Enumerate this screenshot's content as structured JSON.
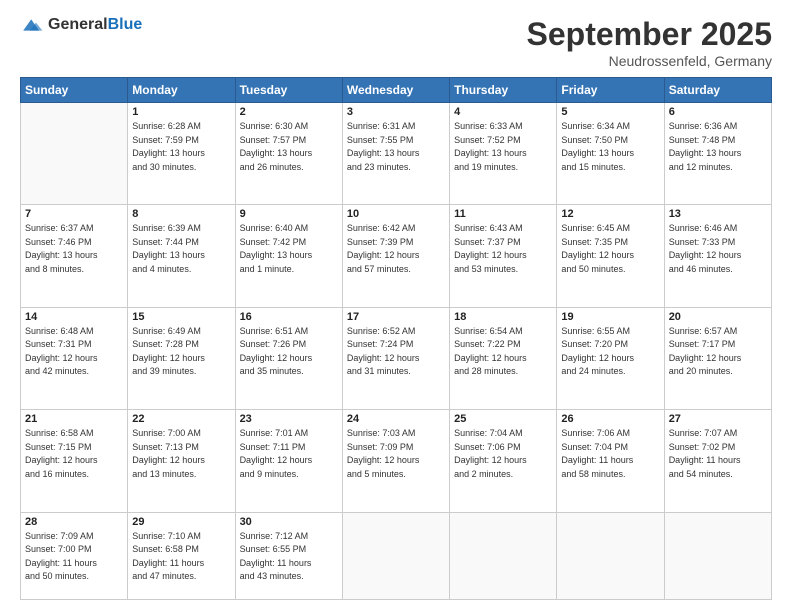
{
  "header": {
    "logo_line1": "General",
    "logo_line2": "Blue",
    "month": "September 2025",
    "location": "Neudrossenfeld, Germany"
  },
  "weekdays": [
    "Sunday",
    "Monday",
    "Tuesday",
    "Wednesday",
    "Thursday",
    "Friday",
    "Saturday"
  ],
  "weeks": [
    [
      {
        "day": "",
        "info": ""
      },
      {
        "day": "1",
        "info": "Sunrise: 6:28 AM\nSunset: 7:59 PM\nDaylight: 13 hours\nand 30 minutes."
      },
      {
        "day": "2",
        "info": "Sunrise: 6:30 AM\nSunset: 7:57 PM\nDaylight: 13 hours\nand 26 minutes."
      },
      {
        "day": "3",
        "info": "Sunrise: 6:31 AM\nSunset: 7:55 PM\nDaylight: 13 hours\nand 23 minutes."
      },
      {
        "day": "4",
        "info": "Sunrise: 6:33 AM\nSunset: 7:52 PM\nDaylight: 13 hours\nand 19 minutes."
      },
      {
        "day": "5",
        "info": "Sunrise: 6:34 AM\nSunset: 7:50 PM\nDaylight: 13 hours\nand 15 minutes."
      },
      {
        "day": "6",
        "info": "Sunrise: 6:36 AM\nSunset: 7:48 PM\nDaylight: 13 hours\nand 12 minutes."
      }
    ],
    [
      {
        "day": "7",
        "info": "Sunrise: 6:37 AM\nSunset: 7:46 PM\nDaylight: 13 hours\nand 8 minutes."
      },
      {
        "day": "8",
        "info": "Sunrise: 6:39 AM\nSunset: 7:44 PM\nDaylight: 13 hours\nand 4 minutes."
      },
      {
        "day": "9",
        "info": "Sunrise: 6:40 AM\nSunset: 7:42 PM\nDaylight: 13 hours\nand 1 minute."
      },
      {
        "day": "10",
        "info": "Sunrise: 6:42 AM\nSunset: 7:39 PM\nDaylight: 12 hours\nand 57 minutes."
      },
      {
        "day": "11",
        "info": "Sunrise: 6:43 AM\nSunset: 7:37 PM\nDaylight: 12 hours\nand 53 minutes."
      },
      {
        "day": "12",
        "info": "Sunrise: 6:45 AM\nSunset: 7:35 PM\nDaylight: 12 hours\nand 50 minutes."
      },
      {
        "day": "13",
        "info": "Sunrise: 6:46 AM\nSunset: 7:33 PM\nDaylight: 12 hours\nand 46 minutes."
      }
    ],
    [
      {
        "day": "14",
        "info": "Sunrise: 6:48 AM\nSunset: 7:31 PM\nDaylight: 12 hours\nand 42 minutes."
      },
      {
        "day": "15",
        "info": "Sunrise: 6:49 AM\nSunset: 7:28 PM\nDaylight: 12 hours\nand 39 minutes."
      },
      {
        "day": "16",
        "info": "Sunrise: 6:51 AM\nSunset: 7:26 PM\nDaylight: 12 hours\nand 35 minutes."
      },
      {
        "day": "17",
        "info": "Sunrise: 6:52 AM\nSunset: 7:24 PM\nDaylight: 12 hours\nand 31 minutes."
      },
      {
        "day": "18",
        "info": "Sunrise: 6:54 AM\nSunset: 7:22 PM\nDaylight: 12 hours\nand 28 minutes."
      },
      {
        "day": "19",
        "info": "Sunrise: 6:55 AM\nSunset: 7:20 PM\nDaylight: 12 hours\nand 24 minutes."
      },
      {
        "day": "20",
        "info": "Sunrise: 6:57 AM\nSunset: 7:17 PM\nDaylight: 12 hours\nand 20 minutes."
      }
    ],
    [
      {
        "day": "21",
        "info": "Sunrise: 6:58 AM\nSunset: 7:15 PM\nDaylight: 12 hours\nand 16 minutes."
      },
      {
        "day": "22",
        "info": "Sunrise: 7:00 AM\nSunset: 7:13 PM\nDaylight: 12 hours\nand 13 minutes."
      },
      {
        "day": "23",
        "info": "Sunrise: 7:01 AM\nSunset: 7:11 PM\nDaylight: 12 hours\nand 9 minutes."
      },
      {
        "day": "24",
        "info": "Sunrise: 7:03 AM\nSunset: 7:09 PM\nDaylight: 12 hours\nand 5 minutes."
      },
      {
        "day": "25",
        "info": "Sunrise: 7:04 AM\nSunset: 7:06 PM\nDaylight: 12 hours\nand 2 minutes."
      },
      {
        "day": "26",
        "info": "Sunrise: 7:06 AM\nSunset: 7:04 PM\nDaylight: 11 hours\nand 58 minutes."
      },
      {
        "day": "27",
        "info": "Sunrise: 7:07 AM\nSunset: 7:02 PM\nDaylight: 11 hours\nand 54 minutes."
      }
    ],
    [
      {
        "day": "28",
        "info": "Sunrise: 7:09 AM\nSunset: 7:00 PM\nDaylight: 11 hours\nand 50 minutes."
      },
      {
        "day": "29",
        "info": "Sunrise: 7:10 AM\nSunset: 6:58 PM\nDaylight: 11 hours\nand 47 minutes."
      },
      {
        "day": "30",
        "info": "Sunrise: 7:12 AM\nSunset: 6:55 PM\nDaylight: 11 hours\nand 43 minutes."
      },
      {
        "day": "",
        "info": ""
      },
      {
        "day": "",
        "info": ""
      },
      {
        "day": "",
        "info": ""
      },
      {
        "day": "",
        "info": ""
      }
    ]
  ]
}
